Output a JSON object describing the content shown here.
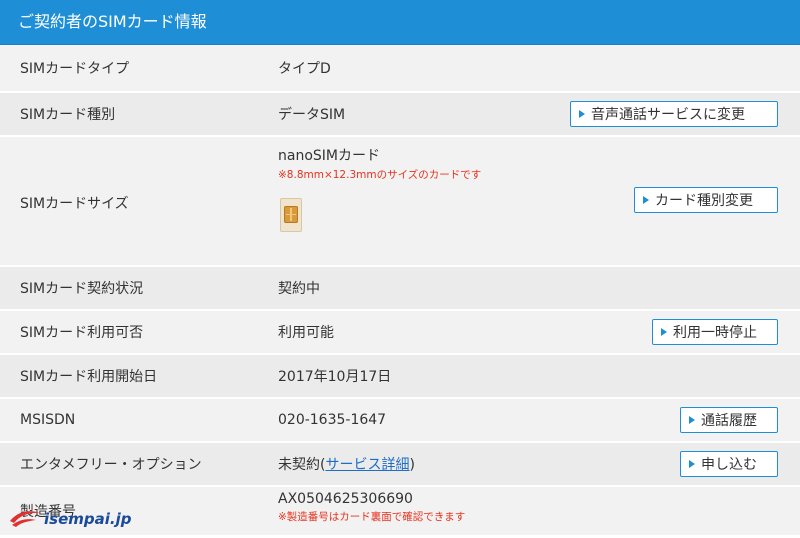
{
  "header": {
    "title": "ご契約者のSIMカード情報"
  },
  "rows": [
    {
      "label": "SIMカードタイプ",
      "value": "タイプD"
    },
    {
      "label": "SIMカード種別",
      "value": "データSIM",
      "button": "音声通話サービスに変更"
    },
    {
      "label": "SIMカードサイズ",
      "value": "nanoSIMカード",
      "note": "※8.8mm×12.3mmのサイズのカードです",
      "button": "カード種別変更"
    },
    {
      "label": "SIMカード契約状況",
      "value": "契約中"
    },
    {
      "label": "SIMカード利用可否",
      "value": "利用可能",
      "button": "利用一時停止"
    },
    {
      "label": "SIMカード利用開始日",
      "value": "2017年10月17日"
    },
    {
      "label": "MSISDN",
      "value": "020-1635-1647",
      "button": "通話履歴"
    },
    {
      "label": "エンタメフリー・オプション",
      "value_prefix": "未契約(",
      "value_link": "サービス詳細",
      "value_suffix": ")",
      "button": "申し込む"
    },
    {
      "label": "製造番号",
      "value": "AX0504625306690",
      "note": "※製造番号はカード裏面で確認できます"
    }
  ],
  "watermark": {
    "text": "isempai.jp"
  },
  "colors": {
    "header": "#1e8fd6",
    "note": "#e8321e",
    "link": "#1e6ec8"
  }
}
